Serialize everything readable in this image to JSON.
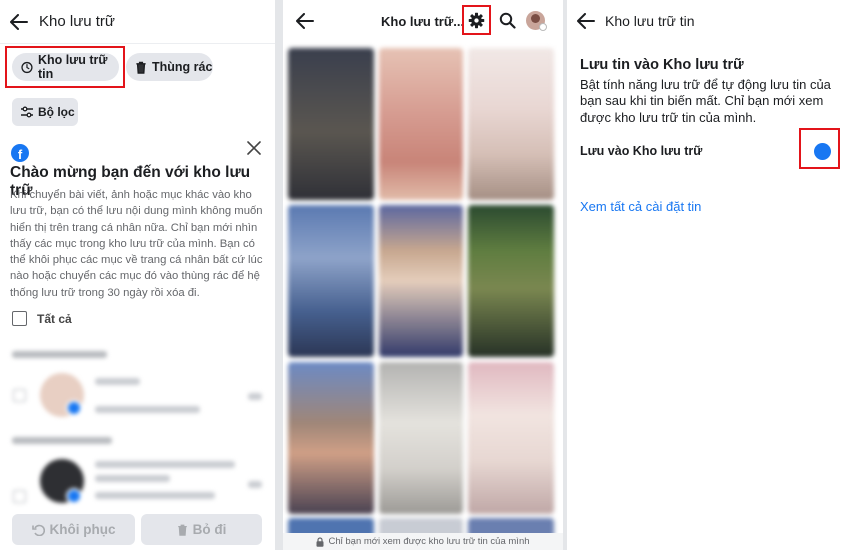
{
  "archive": {
    "title": "Kho lưu trữ",
    "tabs": [
      {
        "label": "Kho lưu trữ tin"
      },
      {
        "label": "Thùng rác"
      }
    ],
    "filter_label": "Bộ lọc",
    "welcome_title": "Chào mừng bạn đến với kho lưu trữ",
    "welcome_body": "Khi chuyển bài viết, ảnh hoặc mục khác vào kho lưu trữ, bạn có thể lưu nội dung mình không muốn hiển thị trên trang cá nhân nữa. Chỉ bạn mới nhìn thấy các mục trong kho lưu trữ của mình. Bạn có thể khôi phục các mục về trang cá nhân bất cứ lúc nào hoặc chuyển các mục đó vào thùng rác để hệ thống lưu trữ trong 30 ngày rồi xóa đi.",
    "select_all_label": "Tất cả",
    "restore_label": "Khôi phục",
    "delete_label": "Bỏ đi"
  },
  "story_archive": {
    "title": "Kho lưu trữ...",
    "privacy_note": "Chỉ bạn mới xem được kho lưu trữ tin của mình"
  },
  "settings": {
    "title": "Kho lưu trữ tin",
    "heading": "Lưu tin vào Kho lưu trữ",
    "description": "Bật tính năng lưu trữ để tự động lưu tin của bạn sau khi tin biến mất. Chỉ bạn mới xem được kho lưu trữ tin của mình.",
    "toggle_label": "Lưu vào Kho lưu trữ",
    "toggle_on": true,
    "see_all_label": "Xem tất cả cài đặt tin"
  },
  "colors": {
    "accent": "#1877f2",
    "highlight": "#e3141a",
    "chip_bg": "#e4e6eb"
  }
}
